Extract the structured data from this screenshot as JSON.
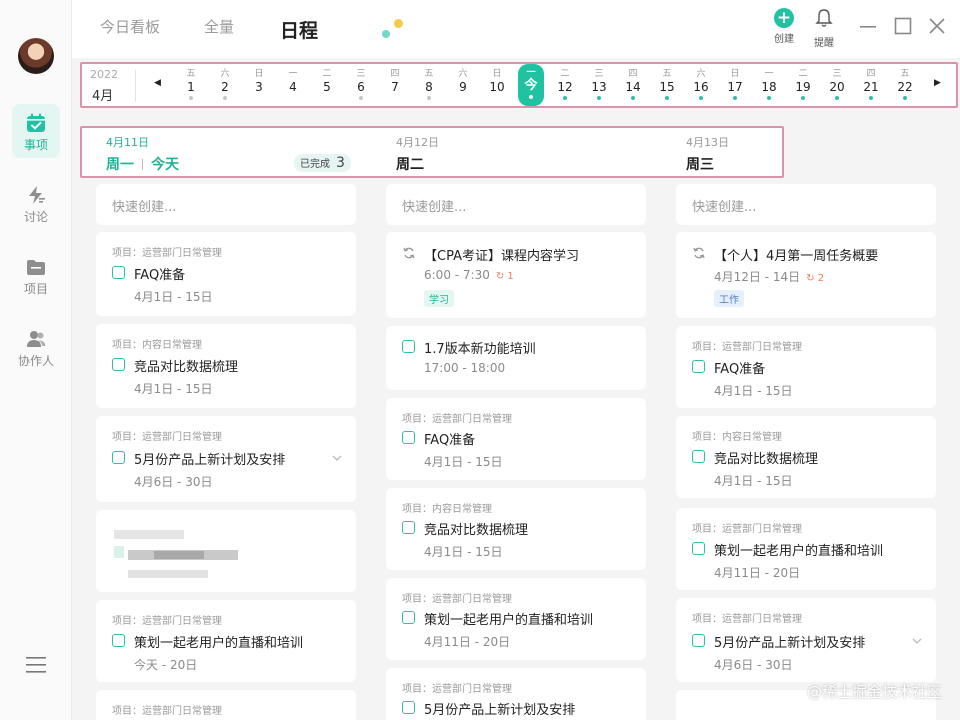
{
  "topbar": {
    "tabs": [
      "今日看板",
      "全量",
      "日程"
    ],
    "create_label": "创建",
    "remind_label": "提醒"
  },
  "sidebar": {
    "items": [
      {
        "label": "事项",
        "icon": "calendar-check-icon",
        "active": true
      },
      {
        "label": "讨论",
        "icon": "lightning-icon",
        "active": false
      },
      {
        "label": "项目",
        "icon": "folder-icon",
        "active": false
      },
      {
        "label": "协作人",
        "icon": "people-icon",
        "active": false
      }
    ]
  },
  "datestrip": {
    "year": "2022",
    "month": "4月",
    "days": [
      {
        "wd": "五",
        "dn": "1",
        "dot": "grey"
      },
      {
        "wd": "六",
        "dn": "2",
        "dot": "grey"
      },
      {
        "wd": "日",
        "dn": "3",
        "dot": ""
      },
      {
        "wd": "一",
        "dn": "4",
        "dot": ""
      },
      {
        "wd": "二",
        "dn": "5",
        "dot": ""
      },
      {
        "wd": "三",
        "dn": "6",
        "dot": "grey"
      },
      {
        "wd": "四",
        "dn": "7",
        "dot": ""
      },
      {
        "wd": "五",
        "dn": "8",
        "dot": "grey"
      },
      {
        "wd": "六",
        "dn": "9",
        "dot": ""
      },
      {
        "wd": "日",
        "dn": "10",
        "dot": ""
      },
      {
        "wd": "一",
        "dn": "今",
        "dot": "teal",
        "today": true
      },
      {
        "wd": "二",
        "dn": "12",
        "dot": "teal"
      },
      {
        "wd": "三",
        "dn": "13",
        "dot": "teal"
      },
      {
        "wd": "四",
        "dn": "14",
        "dot": "teal"
      },
      {
        "wd": "五",
        "dn": "15",
        "dot": "teal"
      },
      {
        "wd": "六",
        "dn": "16",
        "dot": "teal"
      },
      {
        "wd": "日",
        "dn": "17",
        "dot": "teal"
      },
      {
        "wd": "一",
        "dn": "18",
        "dot": "teal"
      },
      {
        "wd": "二",
        "dn": "19",
        "dot": "teal"
      },
      {
        "wd": "三",
        "dn": "20",
        "dot": "teal"
      },
      {
        "wd": "四",
        "dn": "21",
        "dot": "teal"
      },
      {
        "wd": "五",
        "dn": "22",
        "dot": "teal"
      }
    ]
  },
  "columns": [
    {
      "date": "4月11日",
      "day": "周一",
      "today_label": "今天",
      "done_label": "已完成",
      "done_count": "3"
    },
    {
      "date": "4月12日",
      "day": "周二"
    },
    {
      "date": "4月13日",
      "day": "周三"
    }
  ],
  "quick_create": "快速创建...",
  "col1": [
    {
      "project": "项目：运营部门日常管理",
      "title": "FAQ准备",
      "range": "4月1日 - 15日"
    },
    {
      "project": "项目：内容日常管理",
      "title": "竞品对比数据梳理",
      "range": "4月1日 - 15日"
    },
    {
      "project": "项目：运营部门日常管理",
      "title": "5月份产品上新计划及安排",
      "range": "4月6日 - 30日"
    },
    {
      "project": "项目：运营部门日常管理",
      "title": "策划一起老用户的直播和培训",
      "range": "今天 - 20日"
    },
    {
      "project": "项目：运营部门日常管理"
    }
  ],
  "col2": [
    {
      "title": "【CPA考证】课程内容学习",
      "range": "6:00 - 7:30",
      "repeat": "1",
      "tag": "学习"
    },
    {
      "title": "1.7版本新功能培训",
      "range": "17:00 - 18:00"
    },
    {
      "project": "项目：运营部门日常管理",
      "title": "FAQ准备",
      "range": "4月1日 - 15日"
    },
    {
      "project": "项目：内容日常管理",
      "title": "竞品对比数据梳理",
      "range": "4月1日 - 15日"
    },
    {
      "project": "项目：运营部门日常管理",
      "title": "策划一起老用户的直播和培训",
      "range": "4月11日 - 20日"
    },
    {
      "project": "项目：运营部门日常管理",
      "title": "5月份产品上新计划及安排"
    }
  ],
  "col3": [
    {
      "title": "【个人】4月第一周任务概要",
      "range": "4月12日 - 14日",
      "repeat": "2",
      "tag": "工作"
    },
    {
      "project": "项目：运营部门日常管理",
      "title": "FAQ准备",
      "range": "4月1日 - 15日"
    },
    {
      "project": "项目：内容日常管理",
      "title": "竞品对比数据梳理",
      "range": "4月1日 - 15日"
    },
    {
      "project": "项目：运营部门日常管理",
      "title": "策划一起老用户的直播和培训",
      "range": "4月11日 - 20日"
    },
    {
      "project": "项目：运营部门日常管理",
      "title": "5月份产品上新计划及安排",
      "range": "4月6日 - 30日"
    }
  ],
  "watermark": "@稀土掘金技术社区"
}
